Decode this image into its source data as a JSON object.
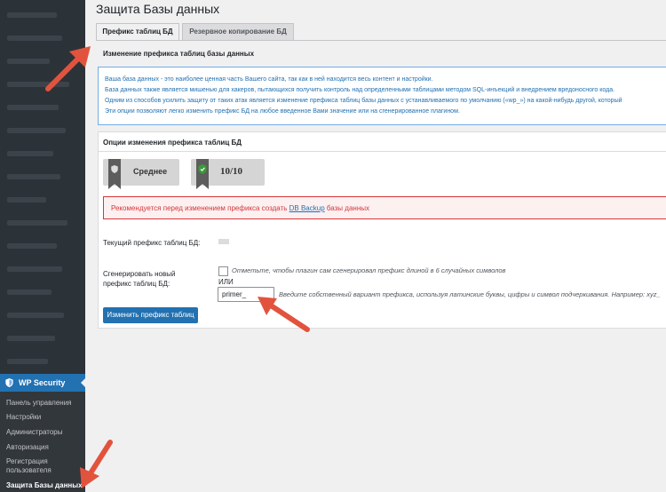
{
  "page": {
    "title": "Защита Базы данных",
    "tabs": [
      "Префикс таблиц БД",
      "Резервное копирование БД"
    ],
    "section_heading": "Изменение префикса таблиц базы данных"
  },
  "info": {
    "lines": [
      "Ваша база данных - это наиболее ценная часть Вашего сайта, так как в ней находится весь контент и настройки.",
      "База данных также является мишенью для хакеров, пытающихся получить контроль над определенными таблицами методом SQL-инъекций и внедрением вредоносного кода.",
      "Одним из способов усилить защиту от таких атак является изменение префикса таблиц базы данных с устанавливаемого по умолчанию («wp_») на какой-нибудь другой, который",
      "Эти опции позволяют легко изменить префикс БД на любое введенное Вами значение или на сгенерированное плагином."
    ]
  },
  "panel": {
    "heading": "Опции изменения префикса таблиц БД",
    "badge_level": "Среднее",
    "badge_score": "10/10",
    "warning_prefix": "Рекомендуется перед изменением префикса создать ",
    "warning_link": "DB Backup",
    "warning_suffix": " базы данных",
    "current_prefix_label": "Текущий префикс таблиц БД:",
    "generate_label_1": "Сгенерировать новый",
    "generate_label_2": "префикс таблиц БД:",
    "checkbox_text": "Отметьте, чтобы плагин сам сгенерировал префикс длиной в 6 случайных символов",
    "or_text": "ИЛИ",
    "prefix_value": "primer_",
    "prefix_hint": "Введите собственный вариант префикса, используя латинские буквы, цифры и символ подчеркивания. Например: xyz_",
    "button": "Изменить префикс таблиц"
  },
  "sidebar": {
    "plugin": "WP Security",
    "items": [
      "Панель управления",
      "Настройки",
      "Администраторы",
      "Авторизация",
      "Регистрация",
      "пользователя",
      "Защита Базы данных"
    ]
  },
  "colors": {
    "accent": "#2271b1",
    "annotation_arrow": "#e2533d",
    "warning": "#d63638"
  }
}
